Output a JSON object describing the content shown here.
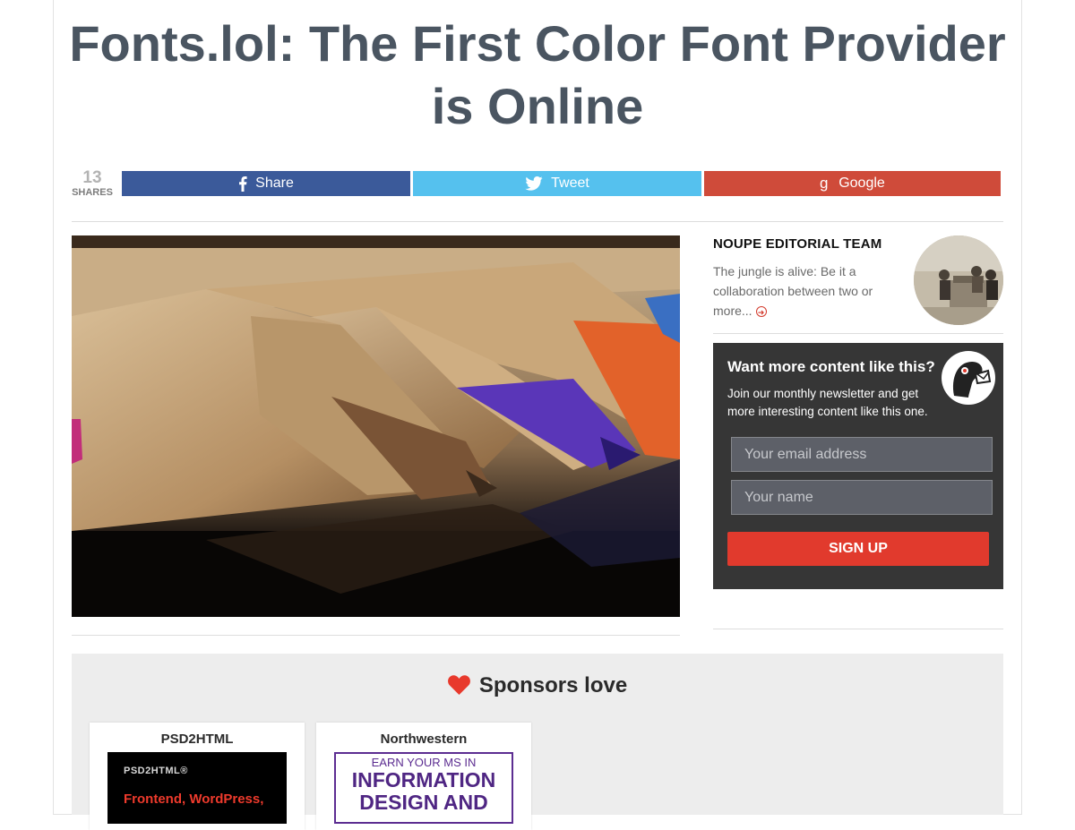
{
  "article": {
    "title": "Fonts.lol: The First Color Font Provider is Online"
  },
  "share": {
    "count": "13",
    "count_label": "SHARES",
    "facebook_label": "Share",
    "twitter_label": "Tweet",
    "google_label": "Google"
  },
  "author": {
    "name": "NOUPE EDITORIAL TEAM",
    "bio": "The jungle is alive: Be it a collaboration between two or more..."
  },
  "newsletter": {
    "heading": "Want more content like this?",
    "text": "Join our monthly newsletter and get more interesting content like this one.",
    "email_placeholder": "Your email address",
    "name_placeholder": "Your name",
    "signup_label": "SIGN UP"
  },
  "sponsors": {
    "title": "Sponsors love",
    "items": [
      {
        "name": "PSD2HTML",
        "banner_logo": "PSD2HTML®",
        "banner_text": "Frontend, WordPress,"
      },
      {
        "name": "Northwestern",
        "banner_small": "EARN YOUR MS IN",
        "banner_big": "INFORMATION DESIGN AND"
      }
    ]
  },
  "colors": {
    "facebook": "#3b5a9a",
    "twitter": "#55c1ee",
    "google": "#cf4b3a",
    "signup": "#e13a2d",
    "title": "#4a5561",
    "heart": "#e8392c"
  },
  "icons": {
    "facebook": "facebook-icon",
    "twitter": "twitter-icon",
    "google": "google-plus-icon",
    "more": "circle-arrow-right-icon",
    "heart": "heart-icon",
    "mascot": "noupe-mascot-icon"
  }
}
